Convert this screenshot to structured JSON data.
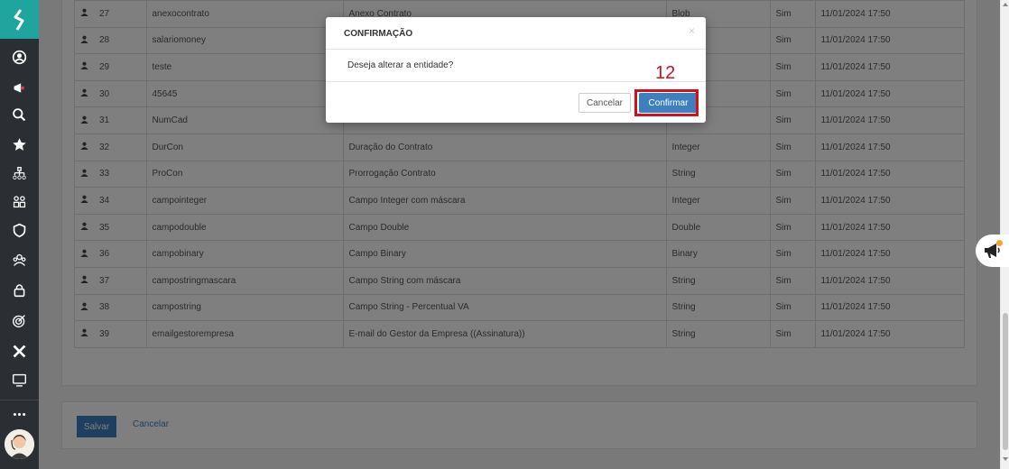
{
  "sidebar": {
    "icons": [
      "logo-icon",
      "user-circle-icon",
      "megaphone-icon",
      "search-icon",
      "star-icon",
      "hierarchy-icon",
      "people-grid-icon",
      "shield-icon",
      "group-icon",
      "lock-icon",
      "target-icon",
      "x-icon",
      "monitor-icon",
      "more-icon"
    ]
  },
  "table": {
    "rows": [
      {
        "num": "27",
        "name": "anexocontrato",
        "desc": "Anexo Contrato",
        "type": "Blob",
        "active": "Sim",
        "date": "11/01/2024 17:50"
      },
      {
        "num": "28",
        "name": "salariomoney",
        "desc": "",
        "type": "",
        "active": "Sim",
        "date": "11/01/2024 17:50"
      },
      {
        "num": "29",
        "name": "teste",
        "desc": "",
        "type": "",
        "active": "Sim",
        "date": "11/01/2024 17:50"
      },
      {
        "num": "30",
        "name": "45645",
        "desc": "",
        "type": "",
        "active": "Sim",
        "date": "11/01/2024 17:50"
      },
      {
        "num": "31",
        "name": "NumCad",
        "desc": "",
        "type": "",
        "active": "Sim",
        "date": "11/01/2024 17:50"
      },
      {
        "num": "32",
        "name": "DurCon",
        "desc": "Duração do Contrato",
        "type": "Integer",
        "active": "Sim",
        "date": "11/01/2024 17:50"
      },
      {
        "num": "33",
        "name": "ProCon",
        "desc": "Prorrogação Contrato",
        "type": "String",
        "active": "Sim",
        "date": "11/01/2024 17:50"
      },
      {
        "num": "34",
        "name": "campointeger",
        "desc": "Campo Integer com máscara",
        "type": "Integer",
        "active": "Sim",
        "date": "11/01/2024 17:50"
      },
      {
        "num": "35",
        "name": "campodouble",
        "desc": "Campo Double",
        "type": "Double",
        "active": "Sim",
        "date": "11/01/2024 17:50"
      },
      {
        "num": "36",
        "name": "campobinary",
        "desc": "Campo Binary",
        "type": "Binary",
        "active": "Sim",
        "date": "11/01/2024 17:50"
      },
      {
        "num": "37",
        "name": "campostringmascara",
        "desc": "Campo String com máscara",
        "type": "String",
        "active": "Sim",
        "date": "11/01/2024 17:50"
      },
      {
        "num": "38",
        "name": "campostring",
        "desc": "Campo String - Percentual VA",
        "type": "String",
        "active": "Sim",
        "date": "11/01/2024 17:50"
      },
      {
        "num": "39",
        "name": "emailgestorempresa",
        "desc": "E-mail do Gestor da Empresa ((Assinatura))",
        "type": "String",
        "active": "Sim",
        "date": "11/01/2024 17:50"
      }
    ]
  },
  "footer": {
    "save_label": "Salvar",
    "cancel_label": "Cancelar"
  },
  "modal": {
    "title": "CONFIRMAÇÃO",
    "close": "×",
    "message": "Deseja alterar a entidade?",
    "cancel_label": "Cancelar",
    "confirm_label": "Confirmar"
  },
  "annotation": {
    "step": "12"
  },
  "colors": {
    "sidebar": "#2b2f33",
    "logo": "#1fa59e",
    "primary": "#3d7fbf",
    "highlight": "#d0121b"
  }
}
